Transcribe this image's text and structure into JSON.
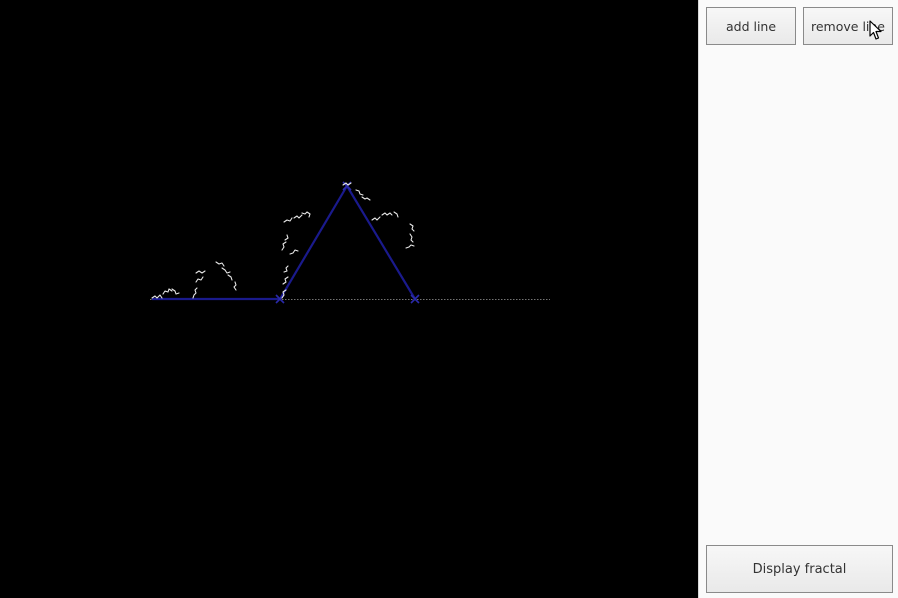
{
  "panel": {
    "add_line_label": "add line",
    "remove_line_label": "remove line",
    "display_fractal_label": "Display fractal"
  },
  "colors": {
    "canvas_background": "#000000",
    "panel_background": "#fafafa",
    "line_color": "#1a1a8c",
    "fractal_color": "#e8e8e8",
    "baseline_color": "#9a9a9a"
  },
  "icons": [
    "mouse-pointer-icon"
  ]
}
